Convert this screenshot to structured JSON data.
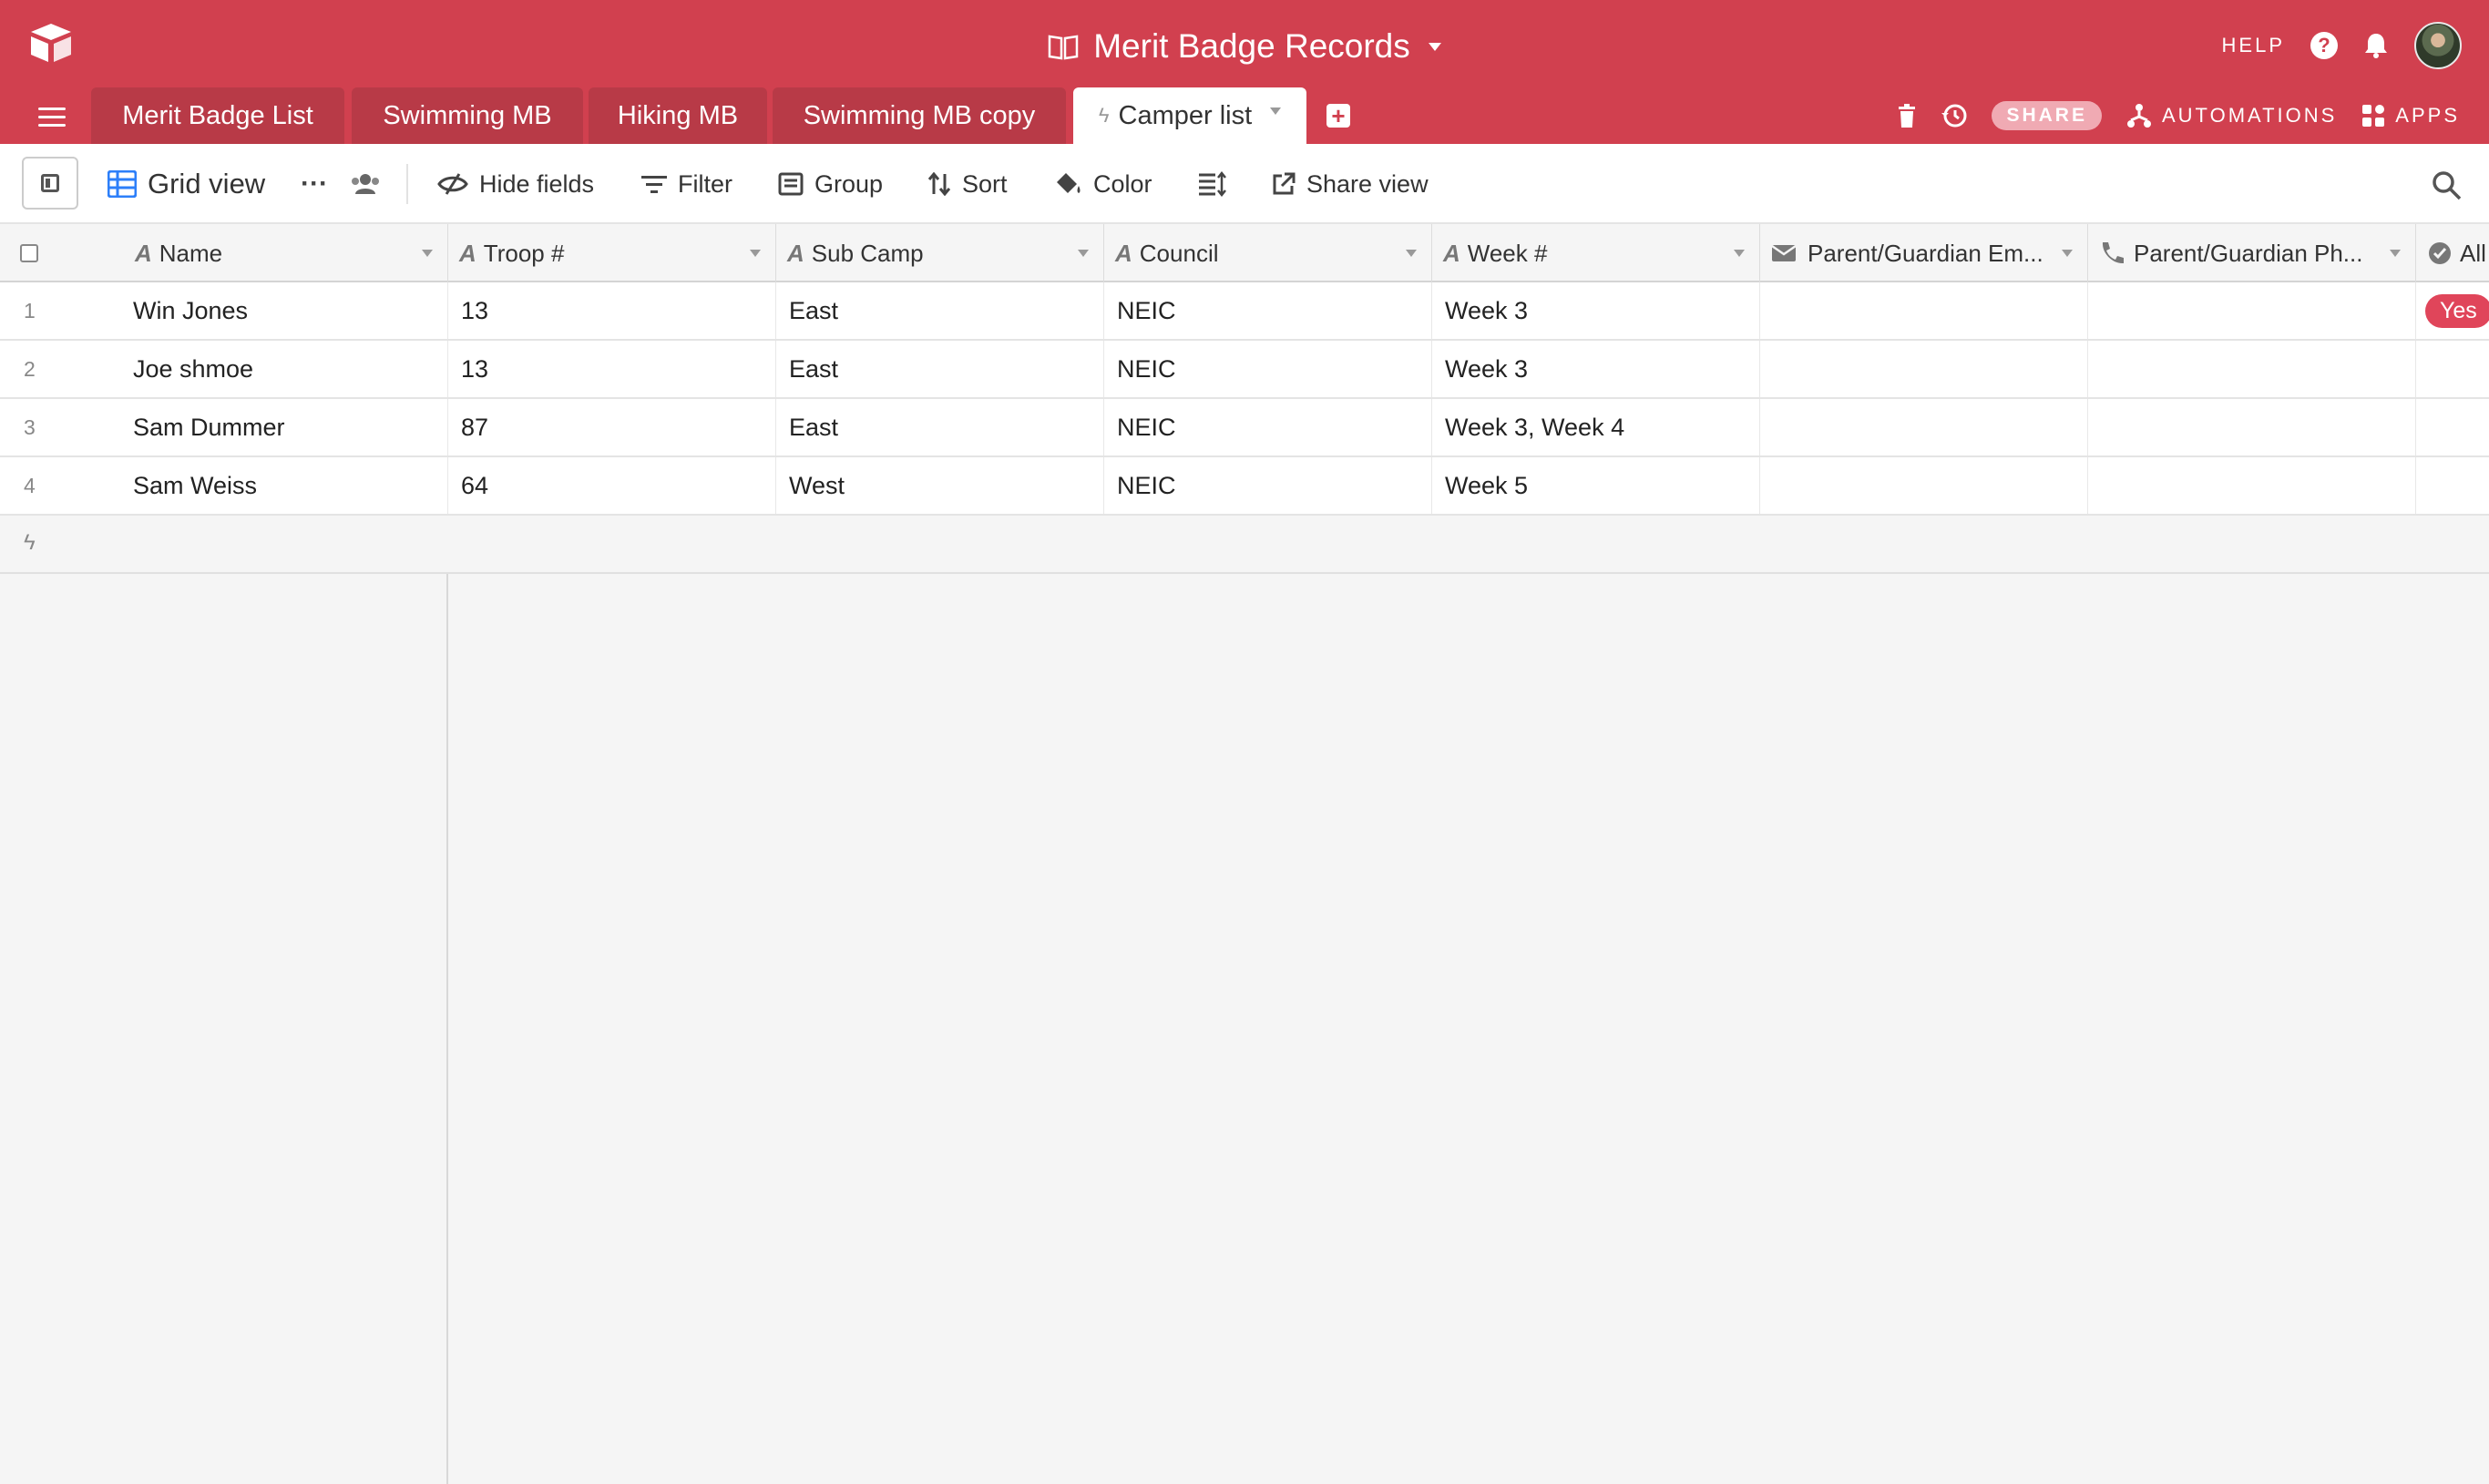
{
  "base": {
    "title": "Merit Badge Records"
  },
  "header": {
    "help_label": "HELP"
  },
  "tabs": [
    {
      "label": "Merit Badge List"
    },
    {
      "label": "Swimming MB"
    },
    {
      "label": "Hiking MB"
    },
    {
      "label": "Swimming MB copy"
    },
    {
      "label": "Camper list",
      "active": true
    }
  ],
  "tabs_right": {
    "share_label": "SHARE",
    "automations_label": "AUTOMATIONS",
    "apps_label": "APPS"
  },
  "toolbar": {
    "view_name": "Grid view",
    "hide_fields": "Hide fields",
    "filter": "Filter",
    "group": "Group",
    "sort": "Sort",
    "color": "Color",
    "share_view": "Share view"
  },
  "columns": [
    {
      "label": "Name",
      "type_icon": "text-field-icon"
    },
    {
      "label": "Troop #",
      "type_icon": "text-field-icon"
    },
    {
      "label": "Sub Camp",
      "type_icon": "text-field-icon"
    },
    {
      "label": "Council",
      "type_icon": "text-field-icon"
    },
    {
      "label": "Week #",
      "type_icon": "text-field-icon"
    },
    {
      "label": "Parent/Guardian Em...",
      "type_icon": "email-field-icon"
    },
    {
      "label": "Parent/Guardian Ph...",
      "type_icon": "phone-field-icon"
    },
    {
      "label": "All",
      "type_icon": "formula-field-icon"
    }
  ],
  "rows": [
    {
      "num": "1",
      "name": "Win Jones",
      "troop": "13",
      "subcamp": "East",
      "council": "NEIC",
      "week": "Week 3",
      "email": "",
      "phone": "",
      "all": "Yes"
    },
    {
      "num": "2",
      "name": "Joe shmoe",
      "troop": "13",
      "subcamp": "East",
      "council": "NEIC",
      "week": "Week 3",
      "email": "",
      "phone": "",
      "all": ""
    },
    {
      "num": "3",
      "name": "Sam Dummer",
      "troop": "87",
      "subcamp": "East",
      "council": "NEIC",
      "week": "Week 3, Week 4",
      "email": "",
      "phone": "",
      "all": ""
    },
    {
      "num": "4",
      "name": "Sam Weiss",
      "troop": "64",
      "subcamp": "West",
      "council": "NEIC",
      "week": "Week 5",
      "email": "",
      "phone": "",
      "all": ""
    }
  ],
  "colors": {
    "brand": "#d1404f",
    "tab_inactive": "#b83a47",
    "pill": "#e0455a"
  }
}
